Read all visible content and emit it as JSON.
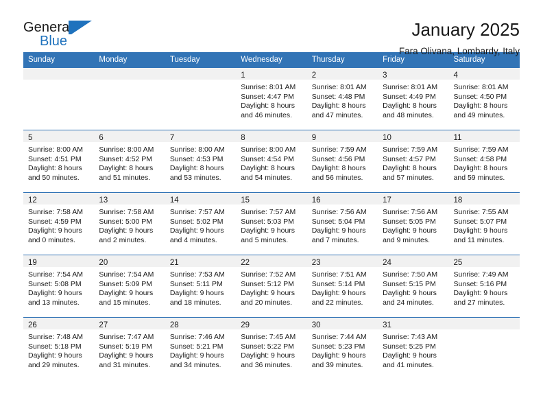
{
  "brand": {
    "name_part1": "General",
    "name_part2": "Blue",
    "mark": "triangle-flag-icon",
    "accent_color": "#1f72bd"
  },
  "header": {
    "title": "January 2025",
    "subtitle": "Fara Olivana, Lombardy, Italy"
  },
  "theme": {
    "header_row_bg": "#3274b6",
    "daynum_strip_bg": "#f1f1f1",
    "text_color": "#1a1a1a"
  },
  "weekday_headers": [
    "Sunday",
    "Monday",
    "Tuesday",
    "Wednesday",
    "Thursday",
    "Friday",
    "Saturday"
  ],
  "weeks": [
    [
      {
        "day": "",
        "empty": true
      },
      {
        "day": "",
        "empty": true
      },
      {
        "day": "",
        "empty": true
      },
      {
        "day": "1",
        "sunrise": "Sunrise: 8:01 AM",
        "sunset": "Sunset: 4:47 PM",
        "daylight_line1": "Daylight: 8 hours",
        "daylight_line2": "and 46 minutes."
      },
      {
        "day": "2",
        "sunrise": "Sunrise: 8:01 AM",
        "sunset": "Sunset: 4:48 PM",
        "daylight_line1": "Daylight: 8 hours",
        "daylight_line2": "and 47 minutes."
      },
      {
        "day": "3",
        "sunrise": "Sunrise: 8:01 AM",
        "sunset": "Sunset: 4:49 PM",
        "daylight_line1": "Daylight: 8 hours",
        "daylight_line2": "and 48 minutes."
      },
      {
        "day": "4",
        "sunrise": "Sunrise: 8:01 AM",
        "sunset": "Sunset: 4:50 PM",
        "daylight_line1": "Daylight: 8 hours",
        "daylight_line2": "and 49 minutes."
      }
    ],
    [
      {
        "day": "5",
        "sunrise": "Sunrise: 8:00 AM",
        "sunset": "Sunset: 4:51 PM",
        "daylight_line1": "Daylight: 8 hours",
        "daylight_line2": "and 50 minutes."
      },
      {
        "day": "6",
        "sunrise": "Sunrise: 8:00 AM",
        "sunset": "Sunset: 4:52 PM",
        "daylight_line1": "Daylight: 8 hours",
        "daylight_line2": "and 51 minutes."
      },
      {
        "day": "7",
        "sunrise": "Sunrise: 8:00 AM",
        "sunset": "Sunset: 4:53 PM",
        "daylight_line1": "Daylight: 8 hours",
        "daylight_line2": "and 53 minutes."
      },
      {
        "day": "8",
        "sunrise": "Sunrise: 8:00 AM",
        "sunset": "Sunset: 4:54 PM",
        "daylight_line1": "Daylight: 8 hours",
        "daylight_line2": "and 54 minutes."
      },
      {
        "day": "9",
        "sunrise": "Sunrise: 7:59 AM",
        "sunset": "Sunset: 4:56 PM",
        "daylight_line1": "Daylight: 8 hours",
        "daylight_line2": "and 56 minutes."
      },
      {
        "day": "10",
        "sunrise": "Sunrise: 7:59 AM",
        "sunset": "Sunset: 4:57 PM",
        "daylight_line1": "Daylight: 8 hours",
        "daylight_line2": "and 57 minutes."
      },
      {
        "day": "11",
        "sunrise": "Sunrise: 7:59 AM",
        "sunset": "Sunset: 4:58 PM",
        "daylight_line1": "Daylight: 8 hours",
        "daylight_line2": "and 59 minutes."
      }
    ],
    [
      {
        "day": "12",
        "sunrise": "Sunrise: 7:58 AM",
        "sunset": "Sunset: 4:59 PM",
        "daylight_line1": "Daylight: 9 hours",
        "daylight_line2": "and 0 minutes."
      },
      {
        "day": "13",
        "sunrise": "Sunrise: 7:58 AM",
        "sunset": "Sunset: 5:00 PM",
        "daylight_line1": "Daylight: 9 hours",
        "daylight_line2": "and 2 minutes."
      },
      {
        "day": "14",
        "sunrise": "Sunrise: 7:57 AM",
        "sunset": "Sunset: 5:02 PM",
        "daylight_line1": "Daylight: 9 hours",
        "daylight_line2": "and 4 minutes."
      },
      {
        "day": "15",
        "sunrise": "Sunrise: 7:57 AM",
        "sunset": "Sunset: 5:03 PM",
        "daylight_line1": "Daylight: 9 hours",
        "daylight_line2": "and 5 minutes."
      },
      {
        "day": "16",
        "sunrise": "Sunrise: 7:56 AM",
        "sunset": "Sunset: 5:04 PM",
        "daylight_line1": "Daylight: 9 hours",
        "daylight_line2": "and 7 minutes."
      },
      {
        "day": "17",
        "sunrise": "Sunrise: 7:56 AM",
        "sunset": "Sunset: 5:05 PM",
        "daylight_line1": "Daylight: 9 hours",
        "daylight_line2": "and 9 minutes."
      },
      {
        "day": "18",
        "sunrise": "Sunrise: 7:55 AM",
        "sunset": "Sunset: 5:07 PM",
        "daylight_line1": "Daylight: 9 hours",
        "daylight_line2": "and 11 minutes."
      }
    ],
    [
      {
        "day": "19",
        "sunrise": "Sunrise: 7:54 AM",
        "sunset": "Sunset: 5:08 PM",
        "daylight_line1": "Daylight: 9 hours",
        "daylight_line2": "and 13 minutes."
      },
      {
        "day": "20",
        "sunrise": "Sunrise: 7:54 AM",
        "sunset": "Sunset: 5:09 PM",
        "daylight_line1": "Daylight: 9 hours",
        "daylight_line2": "and 15 minutes."
      },
      {
        "day": "21",
        "sunrise": "Sunrise: 7:53 AM",
        "sunset": "Sunset: 5:11 PM",
        "daylight_line1": "Daylight: 9 hours",
        "daylight_line2": "and 18 minutes."
      },
      {
        "day": "22",
        "sunrise": "Sunrise: 7:52 AM",
        "sunset": "Sunset: 5:12 PM",
        "daylight_line1": "Daylight: 9 hours",
        "daylight_line2": "and 20 minutes."
      },
      {
        "day": "23",
        "sunrise": "Sunrise: 7:51 AM",
        "sunset": "Sunset: 5:14 PM",
        "daylight_line1": "Daylight: 9 hours",
        "daylight_line2": "and 22 minutes."
      },
      {
        "day": "24",
        "sunrise": "Sunrise: 7:50 AM",
        "sunset": "Sunset: 5:15 PM",
        "daylight_line1": "Daylight: 9 hours",
        "daylight_line2": "and 24 minutes."
      },
      {
        "day": "25",
        "sunrise": "Sunrise: 7:49 AM",
        "sunset": "Sunset: 5:16 PM",
        "daylight_line1": "Daylight: 9 hours",
        "daylight_line2": "and 27 minutes."
      }
    ],
    [
      {
        "day": "26",
        "sunrise": "Sunrise: 7:48 AM",
        "sunset": "Sunset: 5:18 PM",
        "daylight_line1": "Daylight: 9 hours",
        "daylight_line2": "and 29 minutes."
      },
      {
        "day": "27",
        "sunrise": "Sunrise: 7:47 AM",
        "sunset": "Sunset: 5:19 PM",
        "daylight_line1": "Daylight: 9 hours",
        "daylight_line2": "and 31 minutes."
      },
      {
        "day": "28",
        "sunrise": "Sunrise: 7:46 AM",
        "sunset": "Sunset: 5:21 PM",
        "daylight_line1": "Daylight: 9 hours",
        "daylight_line2": "and 34 minutes."
      },
      {
        "day": "29",
        "sunrise": "Sunrise: 7:45 AM",
        "sunset": "Sunset: 5:22 PM",
        "daylight_line1": "Daylight: 9 hours",
        "daylight_line2": "and 36 minutes."
      },
      {
        "day": "30",
        "sunrise": "Sunrise: 7:44 AM",
        "sunset": "Sunset: 5:23 PM",
        "daylight_line1": "Daylight: 9 hours",
        "daylight_line2": "and 39 minutes."
      },
      {
        "day": "31",
        "sunrise": "Sunrise: 7:43 AM",
        "sunset": "Sunset: 5:25 PM",
        "daylight_line1": "Daylight: 9 hours",
        "daylight_line2": "and 41 minutes."
      },
      {
        "day": "",
        "empty": true
      }
    ]
  ]
}
